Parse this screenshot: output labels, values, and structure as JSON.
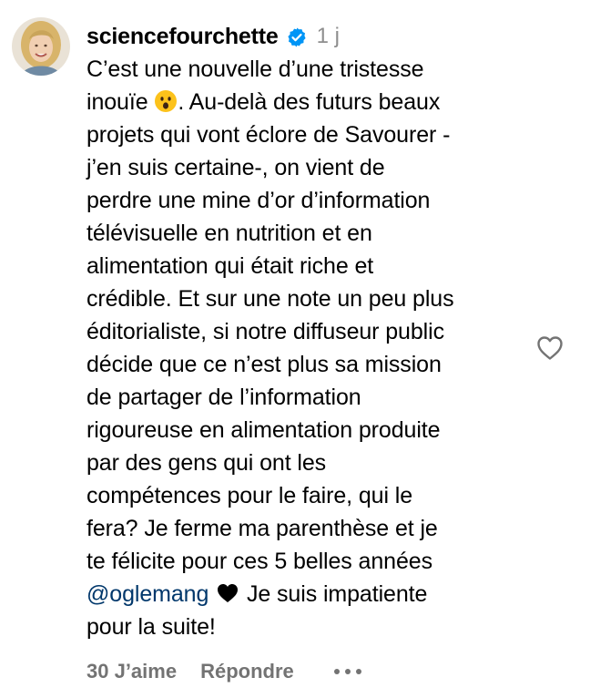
{
  "comment": {
    "username": "sciencefourchette",
    "timestamp": "1 j",
    "text_part1": "C’est une nouvelle d’une tristesse\ninouïe ",
    "text_part2": ". Au-delà des futurs beaux\nprojets qui vont éclore de Savourer -\nj’en suis certaine-, on vient de\nperdre une mine d’or d’information\ntélévisuelle en nutrition et en\nalimentation qui était riche et\ncrédible. Et sur une note un peu plus\néditorialiste, si notre diffuseur public\ndécide que ce n’est plus sa mission\nde partager de l’information\nrigoureuse en alimentation produite\npar des gens qui ont les\ncompétences pour le faire, qui le\nfera? Je ferme ma parenthèse et je\nte félicite pour ces 5 belles années\n",
    "mention": "@oglemang",
    "text_part3": " Je suis impatiente\npour la suite!",
    "emoji_icon": "hushed-face-emoji-icon",
    "inline_heart_icon": "black-heart-icon"
  },
  "footer": {
    "likes_label": "30 J’aime",
    "reply_label": "Répondre",
    "more_icon": "more-options-icon"
  },
  "colors": {
    "text": "#000000",
    "secondary": "#8e8e8e",
    "footer": "#737373",
    "mention": "#00376b",
    "verified": "#0095f6"
  }
}
